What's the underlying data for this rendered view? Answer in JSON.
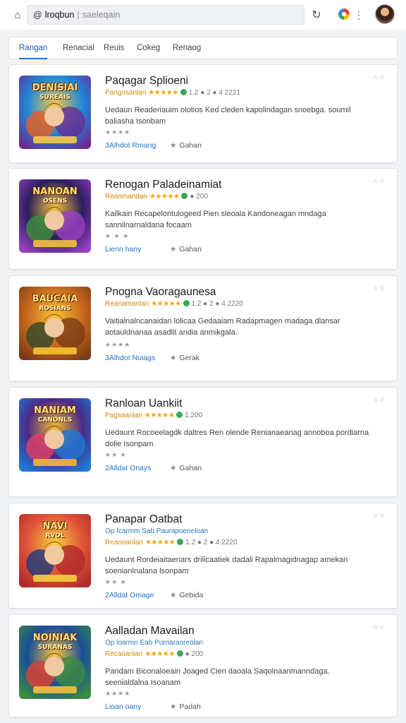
{
  "browser": {
    "address_at": "@",
    "address_query": "lroqbun",
    "address_sep": "|",
    "address_placeholder": "saeleqain"
  },
  "tabs": [
    {
      "label": "Rangan",
      "active": true
    },
    {
      "label": "Renacial"
    },
    {
      "label": "Reuis"
    },
    {
      "label": "Cokeg"
    },
    {
      "label": "Renaog"
    }
  ],
  "rating_stars": "★★★★★",
  "results": [
    {
      "title": "Paqagar Splioeni",
      "meta_label": "Pangosanlan",
      "meta_nums": "1.2 ● 2 ● 4 2221",
      "developer": "",
      "description": "Uedaun Readeriauim olotios Ked cleden kapolindagan snoebga. soumil baliasha Isonbam",
      "small": "★★★★",
      "link": "3Alhdot Rmang",
      "save": "Gahan",
      "corner": "☆☆",
      "icon_text_1": "DENISIAI",
      "icon_text_2": "SUREAIS",
      "palette": [
        "#1e88d8",
        "#f7c948",
        "#e0602a",
        "#6a2c91"
      ]
    },
    {
      "title": "Renogan Paladeinamiat",
      "meta_label": "Reanmandan",
      "meta_nums": "● 200",
      "developer": "",
      "description": "Kailkain Recapelontulogeed Pien sleoala Kandoneagan mndaga sannilnarnaldana focaam",
      "small": "★ ★ ★",
      "link": "Lienn hany",
      "save": "Gahan",
      "corner": "☆☆",
      "icon_text_1": "NANOAN",
      "icon_text_2": "OSENS",
      "palette": [
        "#2a1f5c",
        "#f2c23a",
        "#3d8a3e",
        "#9a3fc4"
      ]
    },
    {
      "title": "Pnogna Vaoragaunesa",
      "meta_label": "Reanamanlan",
      "meta_nums": "1.2 ● 2 ● 4 2220",
      "developer": "",
      "description": "Vaitialnalncanaidan lolicaa Gedaaiam Radapmagen madaga dlansar aotauldnanaa asadlit andia anmikgala.",
      "small": "★★★★",
      "link": "3Alhdot Nuiags",
      "save": "Gerak",
      "corner": "☆☆",
      "icon_text_1": "BAUCAIA",
      "icon_text_2": "ROSIANS",
      "palette": [
        "#c96a1e",
        "#f6c431",
        "#3c4a2a",
        "#7a3b15"
      ]
    },
    {
      "title": "Ranloan Uankiit",
      "meta_label": "Pagsaanlan",
      "meta_nums": "1.200",
      "developer": "",
      "description": "Uedaunt Rocoeelagdk daltres Ren olende Renianaeanag annoboa pordiarna dolie Isonpam",
      "small": "★★ ★",
      "link": "2Alldat Onays",
      "save": "Gahan",
      "corner": "☆☆",
      "icon_text_1": "NANIAM",
      "icon_text_2": "CANONLS",
      "palette": [
        "#4a2a86",
        "#f2b92f",
        "#d93f6b",
        "#1f7ad6"
      ]
    },
    {
      "title": "Panapar Oatbat",
      "meta_label": "Reanoanlan",
      "meta_nums": "1.2 ● 2 ● 4 2220",
      "developer": "Op Icarmm Sab Paurapoeneloan",
      "description": "Uedaunt Rordeiaitaeriars drilicaatiek dadali Rapalmagidnagap amekan soenianlnalana lsonpam",
      "small": "★★ ★",
      "link": "2Alldat Omage",
      "save": "Gebida",
      "corner": "☆☆",
      "icon_text_1": "NAVI",
      "icon_text_2": "RVOL",
      "palette": [
        "#e2553a",
        "#f4d03f",
        "#2a3d7a",
        "#b02a2a"
      ]
    },
    {
      "title": "Aalladan Mavailan",
      "meta_label": "Recaoanlan",
      "meta_nums": "● 200",
      "developer": "Op loarmn Eab Purnaraoreolan",
      "description": "Pandam Biconaloeain Joaged Cien daoala Saqolnaanmanndaga. seenialdalna Isoanam",
      "small": "★★★★",
      "link": "Lioan oany",
      "save": "Padah",
      "corner": "☆☆",
      "icon_text_1": "NOINIAK",
      "icon_text_2": "SURANAS",
      "palette": [
        "#1a4f9a",
        "#f6c23b",
        "#d84332",
        "#3b8c3f"
      ]
    }
  ]
}
